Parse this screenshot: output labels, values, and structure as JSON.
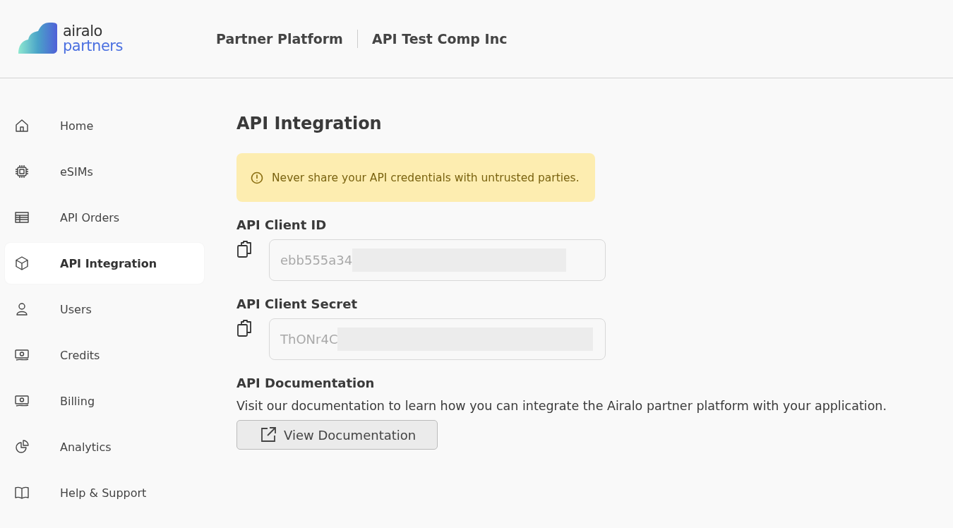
{
  "header": {
    "logo": {
      "line_1": "airalo",
      "line_2": "partners"
    },
    "breadcrumbs": [
      "Partner Platform",
      "API Test Comp Inc"
    ]
  },
  "sidebar": {
    "items": [
      {
        "label": "Home",
        "kind": "home",
        "selected": false
      },
      {
        "label": "eSIMs",
        "kind": "chip",
        "selected": false
      },
      {
        "label": "API Orders",
        "kind": "table",
        "selected": false
      },
      {
        "label": "API Integration",
        "kind": "cube",
        "selected": true
      },
      {
        "label": "Users",
        "kind": "user",
        "selected": false
      },
      {
        "label": "Credits",
        "kind": "money",
        "selected": false
      },
      {
        "label": "Billing",
        "kind": "money",
        "selected": false
      },
      {
        "label": "Analytics",
        "kind": "pie",
        "selected": false
      },
      {
        "label": "Help & Support",
        "kind": "book",
        "selected": false
      }
    ]
  },
  "main": {
    "title": "API Integration",
    "alert": "Never share your API credentials with untrusted parties.",
    "fields": [
      {
        "label": "API Client ID",
        "value": "ebb555a34"
      },
      {
        "label": "API Client Secret",
        "value": "ThONr4C"
      }
    ],
    "documentation": {
      "heading": "API Documentation",
      "text": "Visit our documentation to learn how you can integrate the Airalo partner platform with your application.",
      "button": "View Documentation"
    }
  }
}
